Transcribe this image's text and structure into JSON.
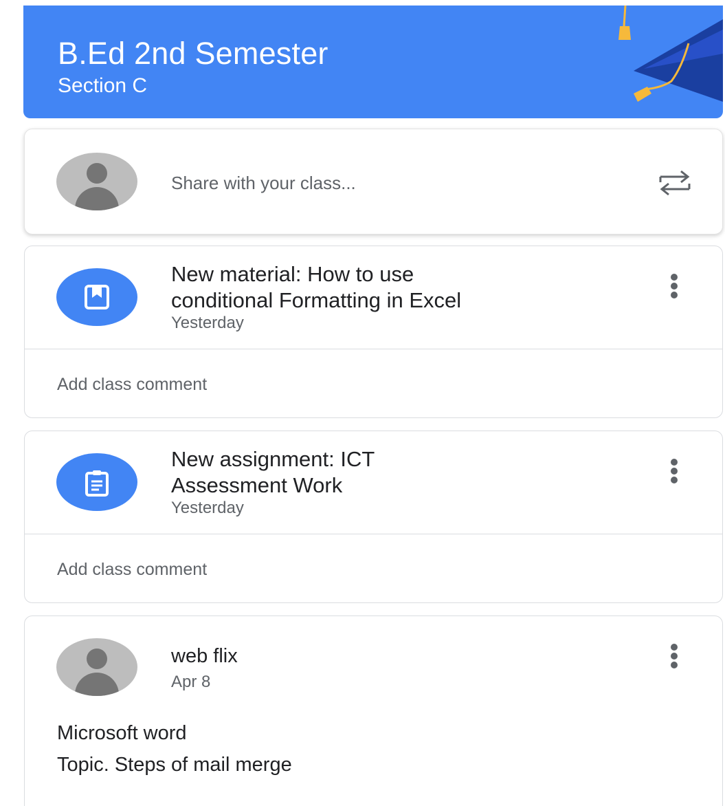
{
  "banner": {
    "title": "B.Ed 2nd Semester",
    "section": "Section C",
    "color": "#4285f4"
  },
  "share": {
    "placeholder": "Share with your class...",
    "avatar_icon": "avatar-icon",
    "action_icon": "repost-icon"
  },
  "posts": [
    {
      "icon": "bookmark-icon",
      "title_line1": "New material: How to use",
      "title_line2": "conditional Formatting in Excel",
      "time": "Yesterday",
      "comment": "Add class comment"
    },
    {
      "icon": "assignment-icon",
      "title_line1": "New assignment: ICT",
      "title_line2": "Assessment Work",
      "time": "Yesterday",
      "comment": "Add class comment"
    }
  ],
  "announcement": {
    "author": "web flix",
    "date": "Apr 8",
    "line1": "Microsoft word",
    "line2": "Topic. Steps of mail merge"
  },
  "colors": {
    "accent": "#4285f4",
    "tassel": "#f6b93b",
    "cap": "#1a3fa0"
  }
}
